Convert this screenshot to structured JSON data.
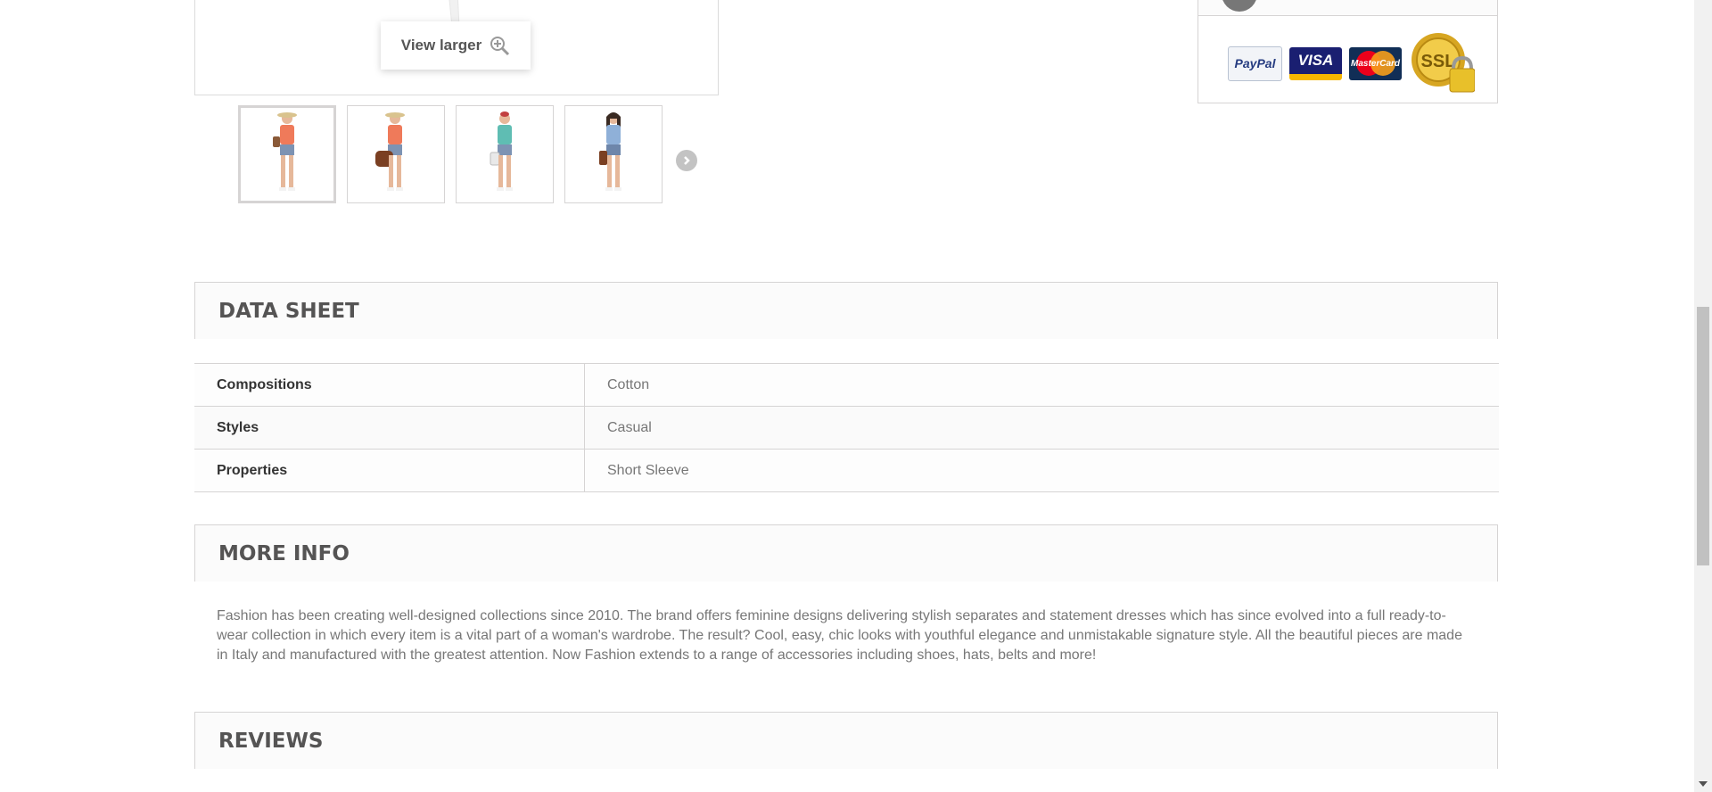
{
  "product_image": {
    "view_larger_label": "View larger",
    "thumbnails": [
      "thumb-1",
      "thumb-2",
      "thumb-3",
      "thumb-4"
    ]
  },
  "payment": {
    "cards": [
      "PayPal",
      "VISA",
      "MasterCard"
    ],
    "ssl_label": "SSL"
  },
  "data_sheet": {
    "title": "DATA SHEET",
    "rows": [
      {
        "key": "Compositions",
        "value": "Cotton"
      },
      {
        "key": "Styles",
        "value": "Casual"
      },
      {
        "key": "Properties",
        "value": "Short Sleeve"
      }
    ]
  },
  "more_info": {
    "title": "MORE INFO",
    "text": "Fashion has been creating well-designed collections since 2010. The brand offers feminine designs delivering stylish separates and statement dresses which has since evolved into a full ready-to-wear collection in which every item is a vital part of a woman's wardrobe. The result? Cool, easy, chic looks with youthful elegance and unmistakable signature style. All the beautiful pieces are made in Italy and manufactured with the greatest attention. Now Fashion extends to a range of accessories including shoes, hats, belts and more!"
  },
  "reviews": {
    "title": "REVIEWS"
  },
  "colors": {
    "border": "#d6d4d4",
    "heading_bg": "#fbfbfb",
    "heading_text": "#555454"
  }
}
